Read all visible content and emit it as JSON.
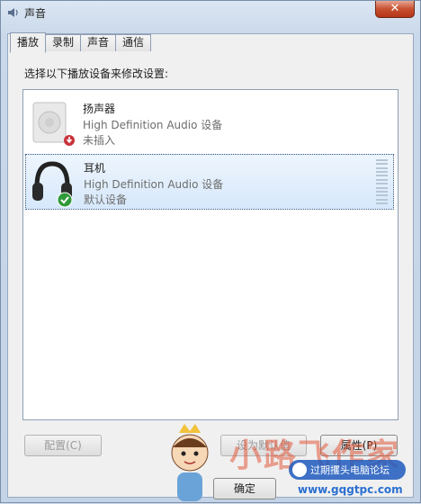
{
  "window": {
    "title": "声音",
    "close_glyph": "✕"
  },
  "tabs": [
    {
      "label": "播放",
      "active": true
    },
    {
      "label": "录制",
      "active": false
    },
    {
      "label": "声音",
      "active": false
    },
    {
      "label": "通信",
      "active": false
    }
  ],
  "instruction": "选择以下播放设备来修改设置:",
  "devices": [
    {
      "name": "扬声器",
      "description": "High Definition Audio 设备",
      "status": "未插入",
      "icon": "speaker-icon",
      "badge": "unplugged-badge-icon",
      "selected": false
    },
    {
      "name": "耳机",
      "description": "High Definition Audio 设备",
      "status": "默认设备",
      "icon": "headphones-icon",
      "badge": "default-check-badge-icon",
      "selected": true
    }
  ],
  "buttons": {
    "configure": "配置(C)",
    "set_default": "设为默认值",
    "properties": "属性(P)",
    "ok": "确定"
  },
  "watermark": {
    "brand": "小路飞作家",
    "site_label": "过期攫头电脑论坛",
    "url": "www.gqgtpc.com"
  }
}
